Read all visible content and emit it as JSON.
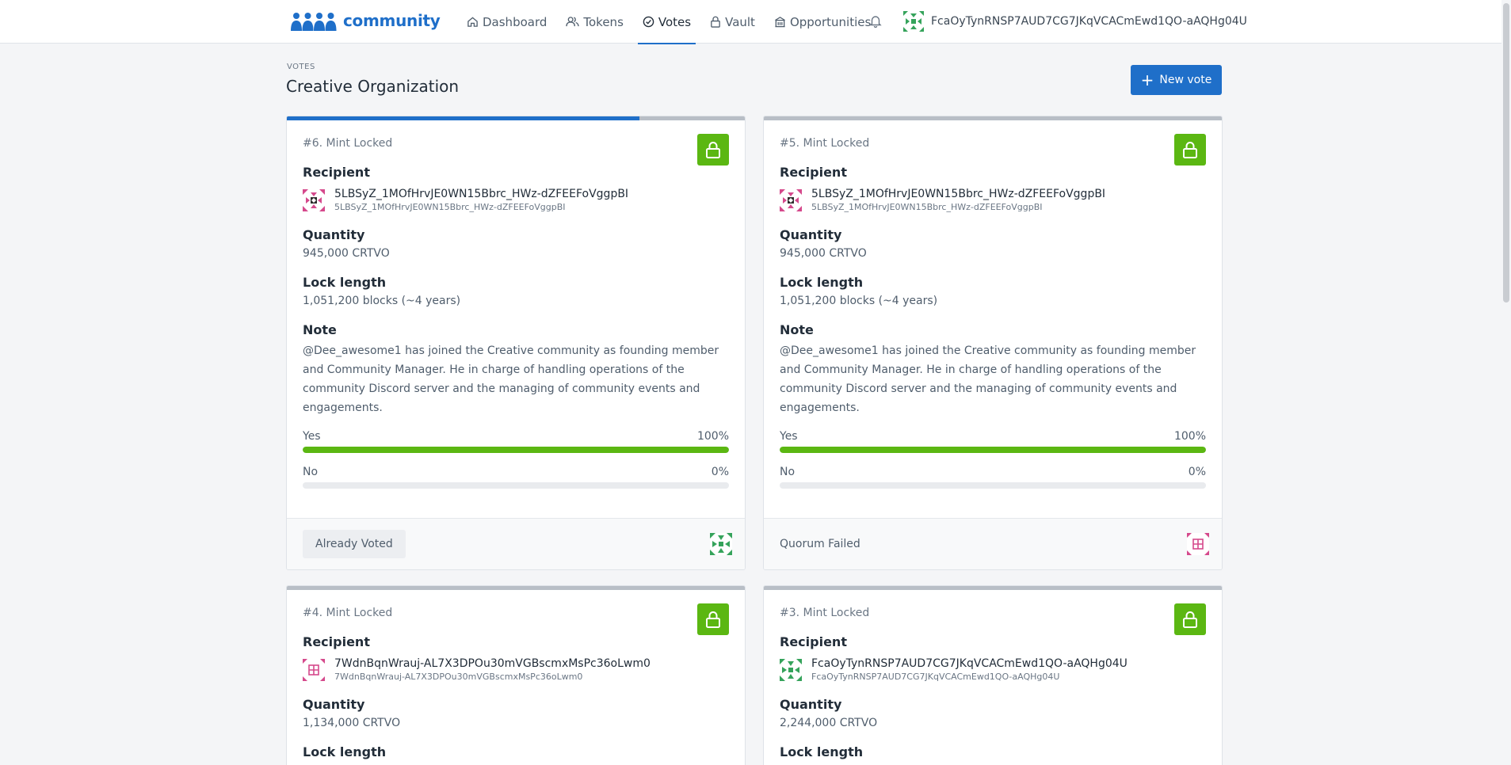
{
  "nav": {
    "brand": "community",
    "items": [
      {
        "label": "Dashboard",
        "icon": "home-icon"
      },
      {
        "label": "Tokens",
        "icon": "users-icon"
      },
      {
        "label": "Votes",
        "icon": "check-circle-icon"
      },
      {
        "label": "Vault",
        "icon": "lock-icon"
      },
      {
        "label": "Opportunities",
        "icon": "building-icon"
      }
    ],
    "active": "Votes",
    "account": "FcaOyTynRNSP7AUD7CG7JKqVCACmEwd1QO-aAQHg04U"
  },
  "header": {
    "eyebrow": "VOTES",
    "title": "Creative Organization",
    "new_vote": "New vote"
  },
  "colors": {
    "accent": "#1f6fc9",
    "success": "#5bb712"
  },
  "labels": {
    "recipient": "Recipient",
    "quantity": "Quantity",
    "lock_length": "Lock length",
    "note": "Note",
    "yes": "Yes",
    "no": "No"
  },
  "votes": [
    {
      "title": "#6. Mint Locked",
      "progress": 0.77,
      "recipient_name": "5LBSyZ_1MOfHrvJE0WN15Bbrc_HWz-dZFEEFoVggpBI",
      "recipient_addr": "5LBSyZ_1MOfHrvJE0WN15Bbrc_HWz-dZFEEFoVggpBI",
      "quantity": "945,000 CRTVO",
      "lock_length": "1,051,200 blocks (~4 years)",
      "note": "@Dee_awesome1 has joined the Creative community as founding member and Community Manager. He in charge of handling operations of the community Discord server and the managing of community events and engagements.",
      "yes_pct": "100%",
      "no_pct": "0%",
      "yes_fraction": 1.0,
      "no_fraction": 0.0,
      "footer": "Already Voted"
    },
    {
      "title": "#5. Mint Locked",
      "progress": 1.0,
      "recipient_name": "5LBSyZ_1MOfHrvJE0WN15Bbrc_HWz-dZFEEFoVggpBI",
      "recipient_addr": "5LBSyZ_1MOfHrvJE0WN15Bbrc_HWz-dZFEEFoVggpBI",
      "quantity": "945,000 CRTVO",
      "lock_length": "1,051,200 blocks (~4 years)",
      "note": "@Dee_awesome1 has joined the Creative community as founding member and Community Manager. He in charge of handling operations of the community Discord server and the managing of community events and engagements.",
      "yes_pct": "100%",
      "no_pct": "0%",
      "yes_fraction": 1.0,
      "no_fraction": 0.0,
      "footer": "Quorum Failed"
    },
    {
      "title": "#4. Mint Locked",
      "progress": 1.0,
      "recipient_name": "7WdnBqnWrauj-AL7X3DPOu30mVGBscmxMsPc36oLwm0",
      "recipient_addr": "7WdnBqnWrauj-AL7X3DPOu30mVGBscmxMsPc36oLwm0",
      "quantity": "1,134,000 CRTVO"
    },
    {
      "title": "#3. Mint Locked",
      "progress": 1.0,
      "recipient_name": "FcaOyTynRNSP7AUD7CG7JKqVCACmEwd1QO-aAQHg04U",
      "recipient_addr": "FcaOyTynRNSP7AUD7CG7JKqVCACmEwd1QO-aAQHg04U",
      "quantity": "2,244,000 CRTVO"
    }
  ]
}
